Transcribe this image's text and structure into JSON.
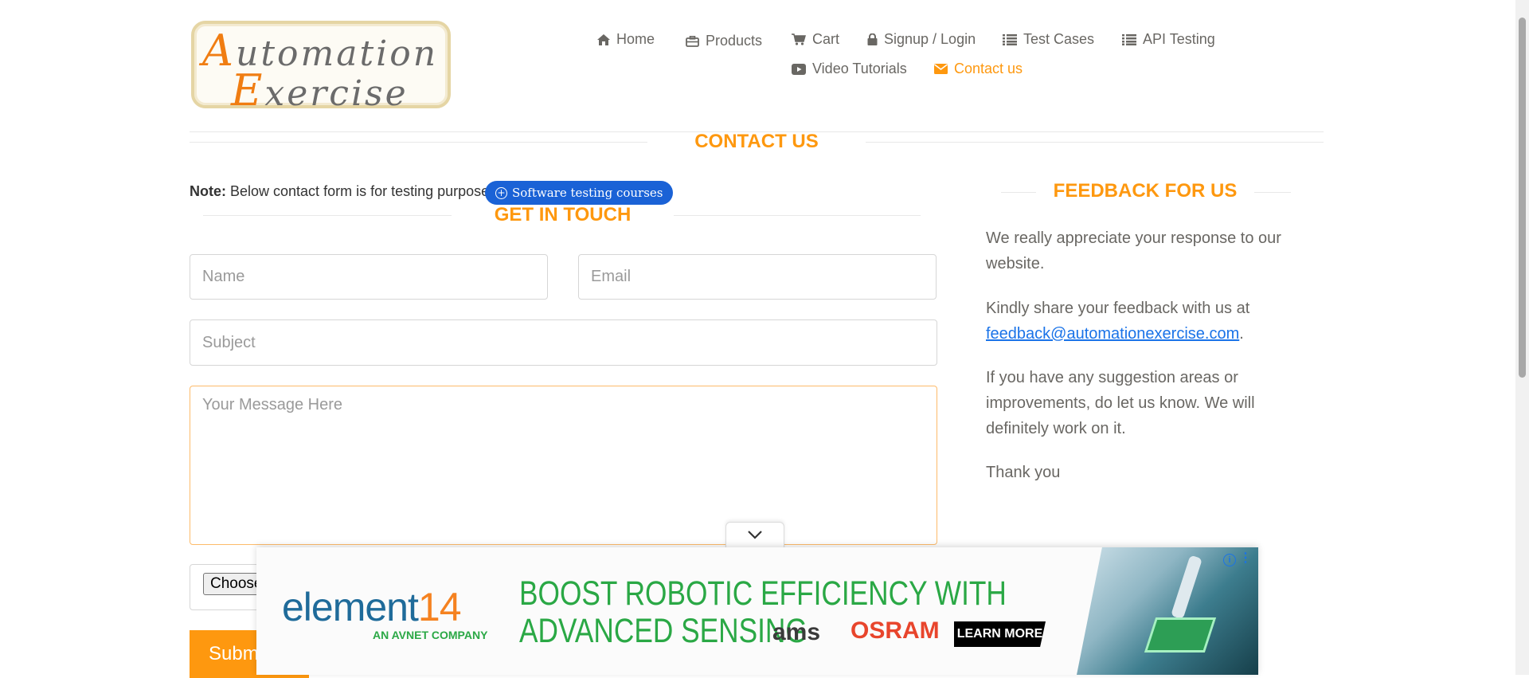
{
  "logo": {
    "line1_cap": "A",
    "line1_rest": "utomation",
    "line2_cap": "E",
    "line2_rest": "xercise"
  },
  "nav": {
    "items": [
      {
        "label": "Home",
        "icon": "home-icon"
      },
      {
        "label": "Products",
        "icon": "briefcase-icon"
      },
      {
        "label": "Cart",
        "icon": "cart-icon"
      },
      {
        "label": "Signup / Login",
        "icon": "lock-icon"
      },
      {
        "label": "Test Cases",
        "icon": "list-icon"
      },
      {
        "label": "API Testing",
        "icon": "list-icon"
      },
      {
        "label": "Video Tutorials",
        "icon": "youtube-icon"
      },
      {
        "label": "Contact us",
        "icon": "envelope-icon",
        "active": true
      }
    ]
  },
  "page": {
    "title": "CONTACT US",
    "note_bold": "Note:",
    "note_text": " Below contact form is for testing purpose.",
    "ad_pill": "Software testing courses"
  },
  "form": {
    "heading": "GET IN TOUCH",
    "name_placeholder": "Name",
    "email_placeholder": "Email",
    "subject_placeholder": "Subject",
    "message_placeholder": "Your Message Here",
    "choose_label": "Choose",
    "submit_label": "Subm"
  },
  "feedback": {
    "heading": "FEEDBACK FOR US",
    "p1": "We really appreciate your response to our website.",
    "p2_before": "Kindly share your feedback with us at ",
    "p2_link": "feedback@automationexercise.com",
    "p2_after": ".",
    "p3": "If you have any suggestion areas or improvements, do let us know. We will definitely work on it.",
    "p4": "Thank you"
  },
  "ad": {
    "brand": "element",
    "brand_num": "14",
    "sub": "AN AVNET COMPANY",
    "headline1": "BOOST ROBOTIC EFFICIENCY WITH",
    "headline2": "ADVANCED SENSING",
    "partner1": "ams",
    "partner2": "OSRAM",
    "cta": "LEARN MORE",
    "info": "i",
    "menu": "⋮"
  },
  "colors": {
    "accent": "#fe980f",
    "link": "#1a73e8",
    "text": "#696763"
  }
}
